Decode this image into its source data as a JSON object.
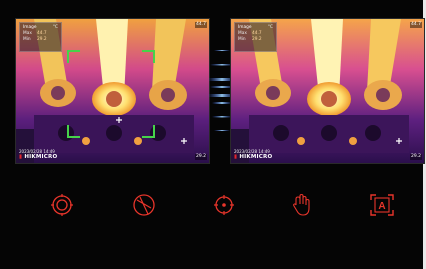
{
  "before_view": {
    "info_title": "Image",
    "info_unit": "°C",
    "max_label": "Max",
    "max_value": "44.7",
    "min_label": "Min",
    "min_value": "29.2",
    "scale_max": "44.7",
    "scale_min": "29.2",
    "timestamp": "2023/02/28 14:49",
    "brand": "HIKMICRO"
  },
  "after_view": {
    "info_title": "Image",
    "info_unit": "°C",
    "max_label": "Max",
    "max_value": "44.7",
    "min_label": "Min",
    "min_value": "29.2",
    "scale_max": "44.7",
    "scale_min": "29.2",
    "timestamp": "2023/02/28 14:49",
    "brand": "HIKMICRO"
  },
  "toolbar": {
    "accent_color": "#e8352b",
    "icons": [
      "target-circle-icon",
      "lens-icon",
      "crosshair-icon",
      "hand-touch-icon",
      "auto-focus-icon"
    ],
    "auto_label": "A"
  }
}
